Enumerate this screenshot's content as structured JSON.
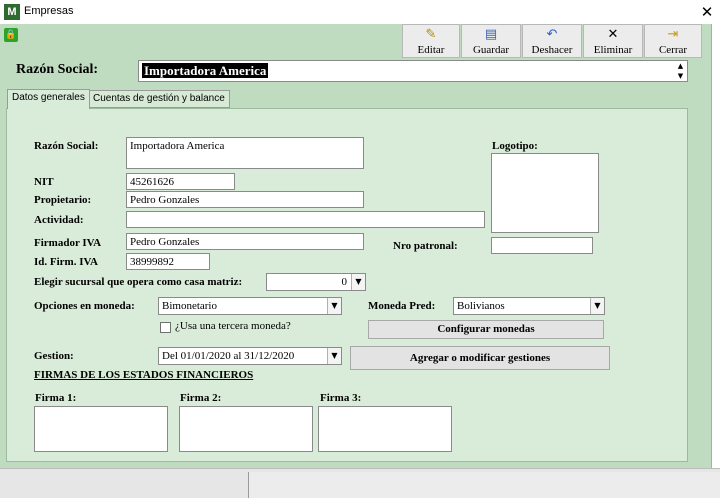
{
  "window": {
    "title": "Empresas",
    "app_icon": "M",
    "close_glyph": "✕"
  },
  "toolbar": {
    "buttons": [
      {
        "label": "Editar",
        "icon": "pencil-icon",
        "glyph": "✎"
      },
      {
        "label": "Guardar",
        "icon": "save-icon",
        "glyph": "▤"
      },
      {
        "label": "Deshacer",
        "icon": "undo-icon",
        "glyph": "↶"
      },
      {
        "label": "Eliminar",
        "icon": "delete-icon",
        "glyph": "✕"
      },
      {
        "label": "Cerrar",
        "icon": "exit-icon",
        "glyph": "⇥"
      }
    ]
  },
  "header": {
    "razon_social_label": "Razón Social:",
    "razon_social_value": "Importadora America"
  },
  "tabs": [
    {
      "label": "Datos generales",
      "active": true
    },
    {
      "label": "Cuentas de gestión y balance",
      "active": false
    }
  ],
  "form": {
    "razon_social": {
      "label": "Razón Social:",
      "value": "Importadora America"
    },
    "nit": {
      "label": "NIT",
      "value": "45261626"
    },
    "propietario": {
      "label": "Propietario:",
      "value": "Pedro Gonzales"
    },
    "actividad": {
      "label": "Actividad:",
      "value": ""
    },
    "firmador_iva": {
      "label": "Firmador IVA",
      "value": "Pedro Gonzales"
    },
    "id_firm_iva": {
      "label": "Id. Firm. IVA",
      "value": "38999892"
    },
    "logotipo": {
      "label": "Logotipo:"
    },
    "nro_patronal": {
      "label": "Nro patronal:",
      "value": ""
    },
    "sucursal": {
      "label": "Elegir sucursal que opera como casa matriz:",
      "value": "0"
    },
    "opciones_moneda": {
      "label": "Opciones en moneda:",
      "value": "Bimonetario"
    },
    "moneda_pred": {
      "label": "Moneda Pred:",
      "value": "Bolivianos"
    },
    "tercera_moneda": {
      "label": "¿Usa una tercera moneda?",
      "checked": false
    },
    "configurar_monedas": {
      "label": "Configurar monedas"
    },
    "gestion": {
      "label": "Gestion:",
      "value": "Del 01/01/2020 al 31/12/2020"
    },
    "agregar_gestiones": {
      "label": "Agregar o modificar gestiones"
    },
    "firmas": {
      "title": "FIRMAS DE LOS ESTADOS FINANCIEROS",
      "items": [
        {
          "label": "Firma 1:"
        },
        {
          "label": "Firma 2:"
        },
        {
          "label": "Firma 3:"
        }
      ]
    }
  },
  "colors": {
    "frame_bg": "#c0dcc0",
    "panel_bg": "#d9ecd9",
    "button_bg": "#ececec"
  }
}
